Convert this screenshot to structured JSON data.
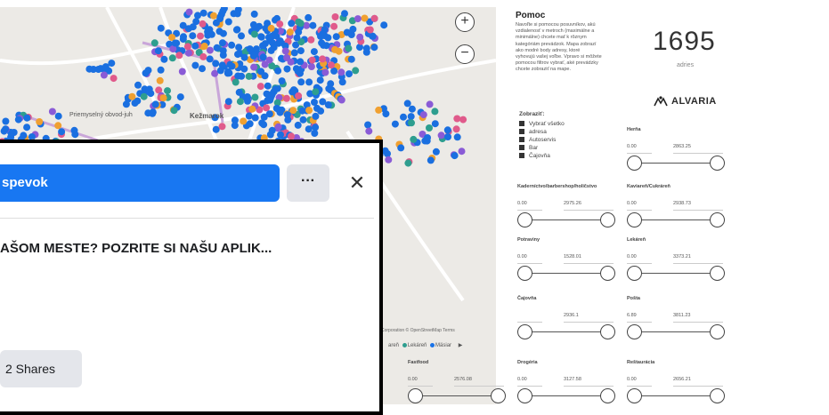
{
  "map": {
    "labels": [
      "Priemyselný obvod-juh",
      "Kežmarok"
    ],
    "attribution": "Corporation © OpenStreetMap Terms",
    "legend": [
      {
        "label": "Lekáreň",
        "color": "#2e9e8f"
      },
      {
        "label": "Mäsiar",
        "color": "#1a73e8"
      }
    ],
    "legend_prefix": "areň",
    "zoom_in": "+",
    "zoom_out": "−"
  },
  "help": {
    "title": "Pomoc",
    "text_lines": [
      "Navoľte si pomocou posuvníkov, akú",
      "vzdialenosť v metroch (maximálne a",
      "minimálne) chcete mať k rôznym",
      "kategóriám prevádzok. Mapa zobrazí",
      "ako modré body adresy, ktoré",
      "vyhovujú vašej voľbe. Vpravo si môžete",
      "pomocou filtrov vybrať, aké prevádzky",
      "chcete zobraziť na mape."
    ]
  },
  "count": {
    "value": "1695",
    "label": "adries"
  },
  "brand": {
    "name": "ALVARIA"
  },
  "show_panel": {
    "title": "Zobraziť:",
    "items": [
      "Vybrať všetko",
      "adresa",
      "Autoservis",
      "Bar",
      "Čajovňa"
    ]
  },
  "filters": [
    {
      "label": "Herňa",
      "min": "0.00",
      "max": "2863.25"
    },
    {
      "label": "Kaderníctvo/barbershop/holičstvo",
      "min": "0.00",
      "max": "2975.26"
    },
    {
      "label": "Kaviareň/Cukráreň",
      "min": "0.00",
      "max": "2938.73"
    },
    {
      "label": "Potraviny",
      "min": "0.00",
      "max": "1528.01"
    },
    {
      "label": "Lekáreň",
      "min": "0.00",
      "max": "3373.21"
    },
    {
      "label": "Čajovňa",
      "min": "",
      "max": "2936.1"
    },
    {
      "label": "Pošta",
      "min": "6.89",
      "max": "3811.23"
    },
    {
      "label": "Fastfood",
      "min": "0.00",
      "max": "2576.08"
    },
    {
      "label": "Drogéria",
      "min": "0.00",
      "max": "3127.58"
    },
    {
      "label": "Reštaurácia",
      "min": "0.00",
      "max": "2656.21"
    }
  ],
  "popup": {
    "post_button": "spevok",
    "more": "···",
    "close": "✕",
    "title": "AŠOM MESTE? POZRITE SI NAŠU APLIK...",
    "shares": "2 Shares"
  },
  "colors": {
    "accent": "#1877f2",
    "dot": "#1a6fe0"
  }
}
